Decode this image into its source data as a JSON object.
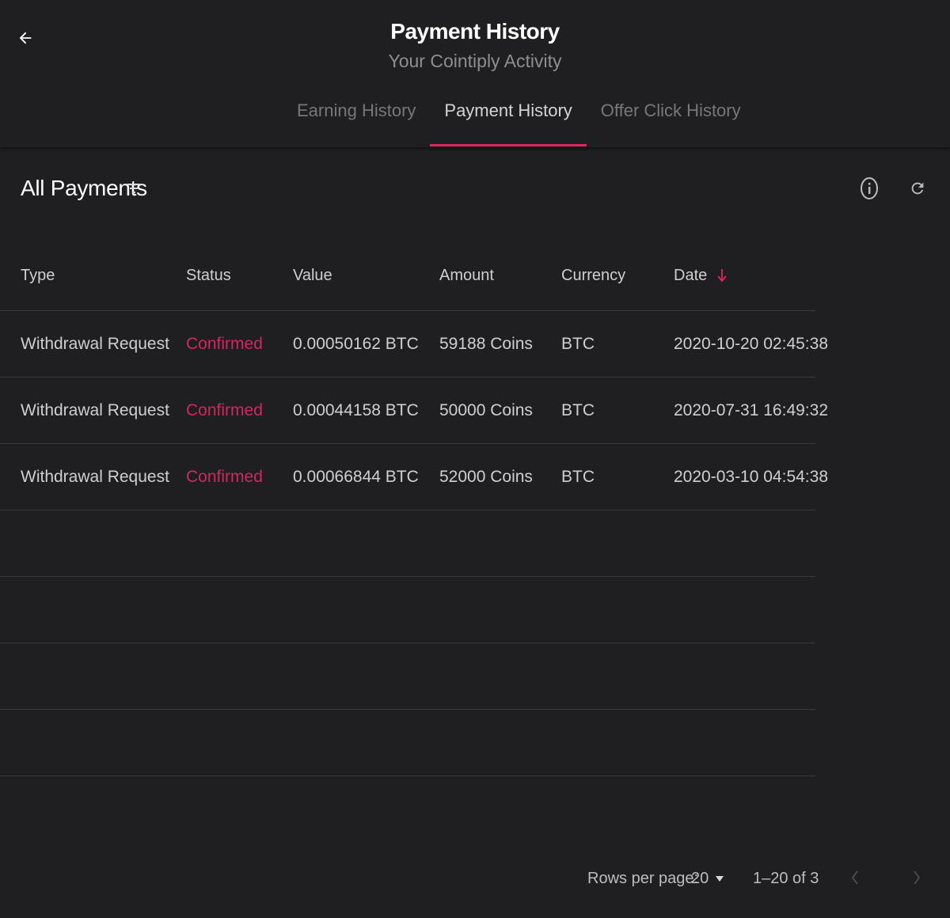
{
  "header": {
    "title": "Payment History",
    "subtitle": "Your Cointiply Activity",
    "tabs": [
      {
        "label": "Earning History",
        "active": false
      },
      {
        "label": "Payment History",
        "active": true
      },
      {
        "label": "Offer Click History",
        "active": false
      }
    ],
    "back_icon": "arrow-left-icon"
  },
  "toolbar": {
    "title": "All Payments",
    "filter_icon": "filter-icon",
    "info_icon": "info-icon",
    "refresh_icon": "refresh-icon"
  },
  "table": {
    "columns": [
      "Type",
      "Status",
      "Value",
      "Amount",
      "Currency",
      "Date"
    ],
    "sort_column": "Date",
    "sort_direction": "descending",
    "rows": [
      {
        "type": "Withdrawal Request",
        "status": "Confirmed",
        "value": "0.00050162 BTC",
        "amount": "59188 Coins",
        "currency": "BTC",
        "date": "2020-10-20 02:45:38"
      },
      {
        "type": "Withdrawal Request",
        "status": "Confirmed",
        "value": "0.00044158 BTC",
        "amount": "50000 Coins",
        "currency": "BTC",
        "date": "2020-07-31 16:49:32"
      },
      {
        "type": "Withdrawal Request",
        "status": "Confirmed",
        "value": "0.00066844 BTC",
        "amount": "52000 Coins",
        "currency": "BTC",
        "date": "2020-03-10 04:54:38"
      }
    ]
  },
  "pagination": {
    "rows_per_page_label": "Rows per page:",
    "rows_per_page": "20",
    "range": "1–20 of 3"
  },
  "colors": {
    "background": "#1f1f21",
    "accent": "#e0265e",
    "status_confirmed": "#d1285e",
    "divider": "#3a3a3d"
  }
}
